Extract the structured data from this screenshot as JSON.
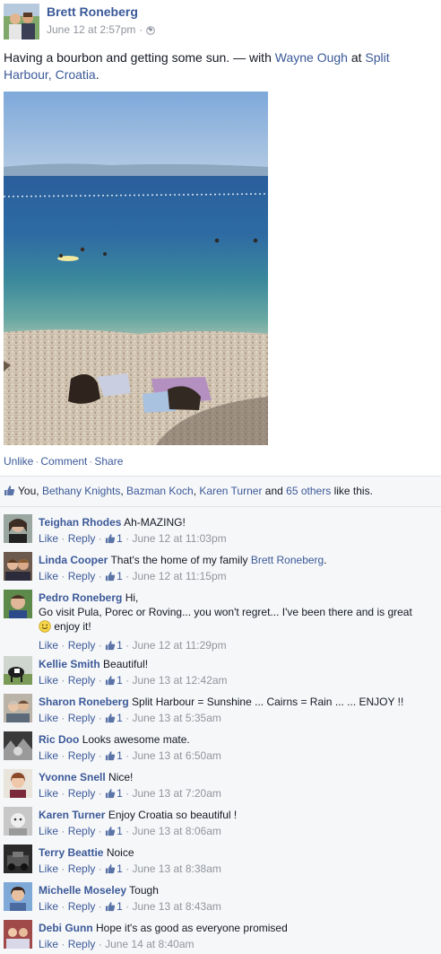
{
  "post": {
    "author": "Brett Roneberg",
    "timestamp": "June 12 at 2:57pm",
    "text_prefix": "Having a bourbon and getting some sun.",
    "text_with": "— with",
    "tagged_person": "Wayne Ough",
    "text_at": "at",
    "location": "Split Harbour, Croatia",
    "text_suffix": ".",
    "actions": {
      "unlike": "Unlike",
      "comment": "Comment",
      "share": "Share",
      "separator": "·"
    }
  },
  "likes": {
    "you": "You,",
    "people": [
      "Bethany Knights",
      "Bazman Koch",
      "Karen Turner"
    ],
    "and_text": "and",
    "others_link": "65 others",
    "suffix": "like this."
  },
  "comments": [
    {
      "name": "Teighan Rhodes",
      "text": "Ah-MAZING!",
      "like": "Like",
      "reply": "Reply",
      "likes": "1",
      "time": "June 12 at 11:03pm"
    },
    {
      "name": "Linda Cooper",
      "text": "That's the home of my family",
      "mention": "Brett Roneberg",
      "text_after": ".",
      "like": "Like",
      "reply": "Reply",
      "likes": "1",
      "time": "June 12 at 11:15pm"
    },
    {
      "name": "Pedro Roneberg",
      "text": "Hi,",
      "text2": "Go visit Pula, Porec or Roving... you won't regret... I've been there and is great",
      "text3": "enjoy it!",
      "like": "Like",
      "reply": "Reply",
      "likes": "1",
      "time": "June 12 at 11:29pm"
    },
    {
      "name": "Kellie Smith",
      "text": "Beautiful!",
      "like": "Like",
      "reply": "Reply",
      "likes": "1",
      "time": "June 13 at 12:42am"
    },
    {
      "name": "Sharon Roneberg",
      "text": "Split Harbour = Sunshine ... Cairns = Rain ... ... ENJOY !!",
      "like": "Like",
      "reply": "Reply",
      "likes": "1",
      "time": "June 13 at 5:35am"
    },
    {
      "name": "Ric Doo",
      "text": "Looks awesome mate.",
      "like": "Like",
      "reply": "Reply",
      "likes": "1",
      "time": "June 13 at 6:50am"
    },
    {
      "name": "Yvonne Snell",
      "text": "Nice!",
      "like": "Like",
      "reply": "Reply",
      "likes": "1",
      "time": "June 13 at 7:20am"
    },
    {
      "name": "Karen Turner",
      "text": "Enjoy Croatia so beautiful !",
      "like": "Like",
      "reply": "Reply",
      "likes": "1",
      "time": "June 13 at 8:06am"
    },
    {
      "name": "Terry Beattie",
      "text": "Noice",
      "like": "Like",
      "reply": "Reply",
      "likes": "1",
      "time": "June 13 at 8:38am"
    },
    {
      "name": "Michelle Moseley",
      "text": "Tough",
      "like": "Like",
      "reply": "Reply",
      "likes": "1",
      "time": "June 13 at 8:43am"
    },
    {
      "name": "Debi Gunn",
      "text": "Hope it's as good as everyone promised",
      "like": "Like",
      "reply": "Reply",
      "time": "June 14 at 8:40am"
    }
  ],
  "separators": {
    "dot": "·"
  }
}
